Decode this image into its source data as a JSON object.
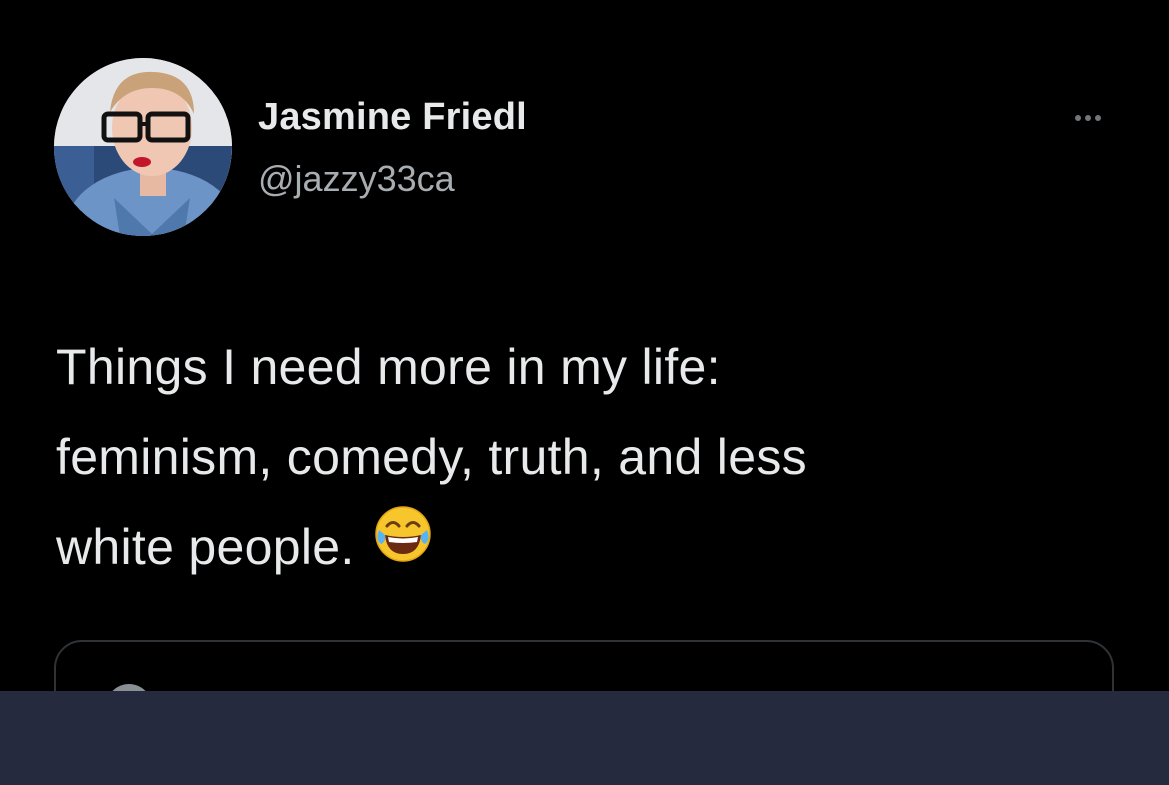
{
  "tweet": {
    "author": {
      "display_name": "Jasmine Friedl",
      "handle": "@jazzy33ca",
      "avatar_icon": "profile-photo"
    },
    "more_icon": "more-options-icon",
    "text_lines": [
      "Things I need more in my life:",
      "feminism, comedy, truth, and less",
      "white people."
    ],
    "emoji_icon": "face-with-tears-of-joy-icon"
  },
  "colors": {
    "background": "#000000",
    "primary_text": "#e7e9ea",
    "secondary_text": "#a8adb2",
    "border": "#2f3336",
    "bottom_bar": "#262a3e"
  }
}
